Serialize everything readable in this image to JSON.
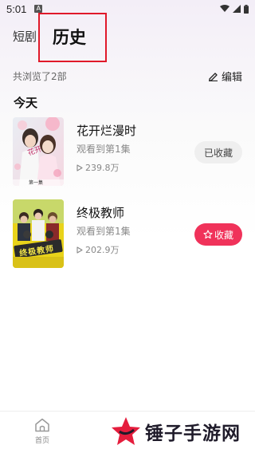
{
  "status_bar": {
    "time": "5:01"
  },
  "tabs": {
    "short_drama": "短剧",
    "history": "历史"
  },
  "summary": {
    "count_text": "共浏览了2部",
    "edit_label": "编辑"
  },
  "section": {
    "title": "今天"
  },
  "items": [
    {
      "title": "花开烂漫时",
      "progress": "观看到第1集",
      "plays": "239.8万",
      "button": "已收藏",
      "collected": true
    },
    {
      "title": "终极教师",
      "progress": "观看到第1集",
      "plays": "202.9万",
      "button": "收藏",
      "collected": false
    }
  ],
  "posters": [
    {
      "episode_tag": "第一集"
    },
    {
      "art_text": "终极教师"
    }
  ],
  "bottom_nav": {
    "home_label": "首页"
  },
  "watermark": {
    "text": "锤子手游网"
  },
  "colors": {
    "accent": "#f0325a",
    "highlight": "#e0192a"
  }
}
